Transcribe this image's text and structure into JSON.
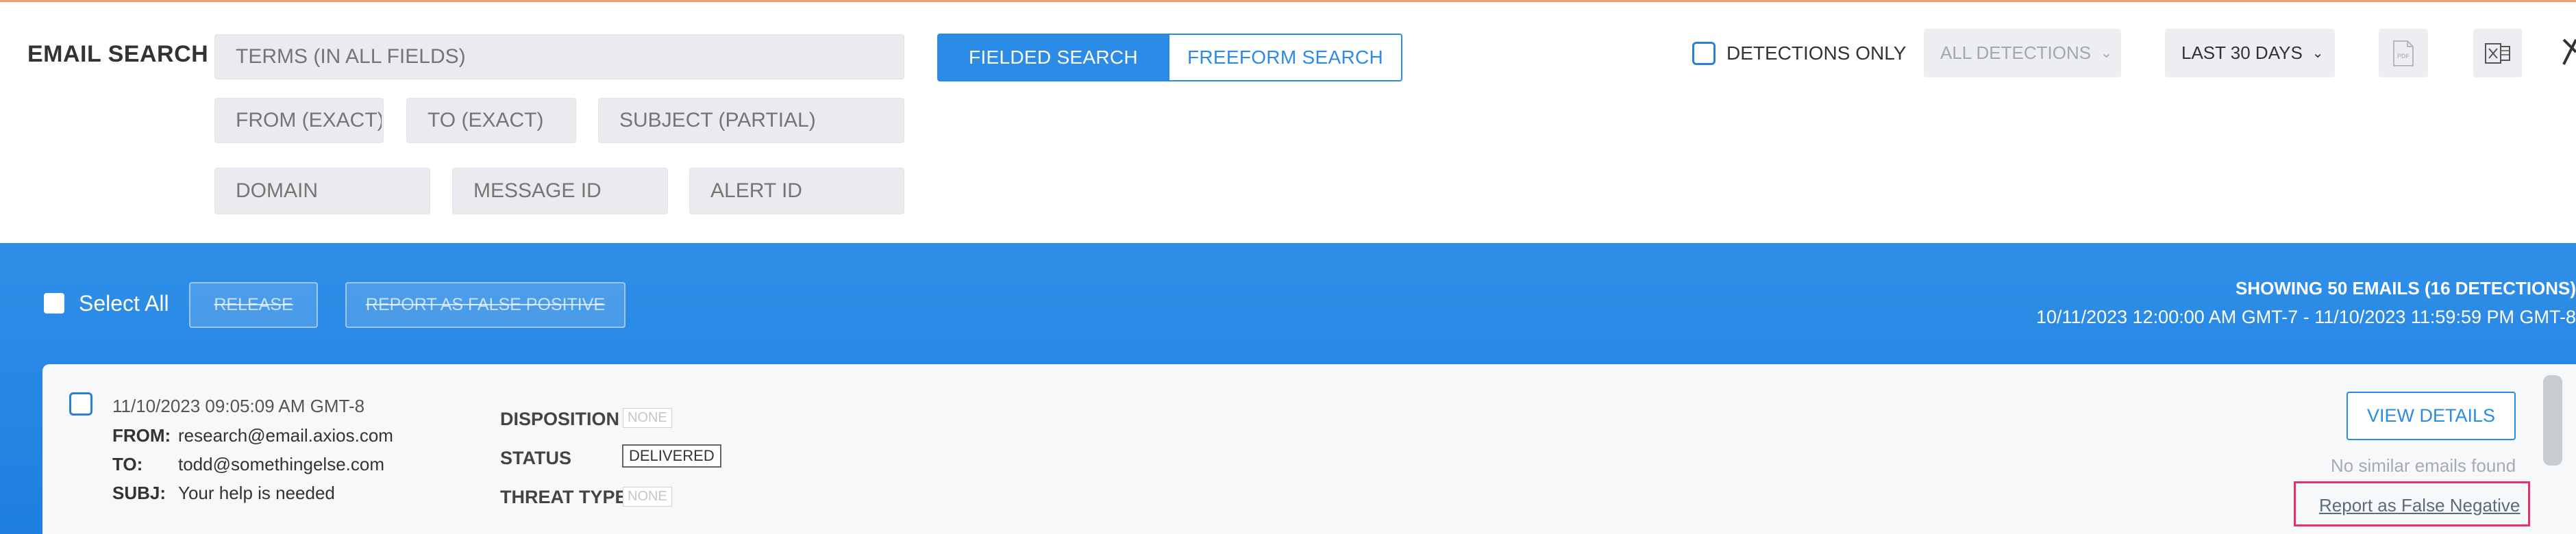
{
  "header": {
    "title": "EMAIL SEARCH",
    "terms_placeholder": "TERMS (IN ALL FIELDS)",
    "from_placeholder": "FROM (EXACT)",
    "to_placeholder": "TO (EXACT)",
    "subject_placeholder": "SUBJECT (PARTIAL)",
    "domain_placeholder": "DOMAIN",
    "message_id_placeholder": "MESSAGE ID",
    "alert_id_placeholder": "ALERT ID",
    "tabs": {
      "fielded": "FIELDED SEARCH",
      "freeform": "FREEFORM SEARCH"
    },
    "detections_only_label": "DETECTIONS ONLY",
    "all_detections": "ALL DETECTIONS",
    "date_range": "LAST 30 DAYS",
    "pdf_icon_label": "PDF"
  },
  "toolbar": {
    "select_all": "Select All",
    "release": "RELEASE",
    "report_fp": "REPORT AS FALSE POSITIVE",
    "showing": "SHOWING 50 EMAILS (16 DETECTIONS)",
    "range": "10/11/2023 12:00:00 AM GMT-7 - 11/10/2023 11:59:59 PM GMT-8"
  },
  "email": {
    "timestamp": "11/10/2023 09:05:09 AM GMT-8",
    "from_label": "FROM:",
    "from": "research@email.axios.com",
    "to_label": "TO:",
    "to": "todd@somethingelse.com",
    "subj_label": "SUBJ:",
    "subject": "Your help is needed",
    "disposition_label": "DISPOSITION",
    "disposition": "NONE",
    "status_label": "STATUS",
    "status": "DELIVERED",
    "threat_label": "THREAT TYPE",
    "threat": "NONE",
    "view_details": "VIEW DETAILS",
    "similar": "No similar emails found",
    "report_fn": "Report as False Negative"
  },
  "colors": {
    "accent": "#2b8be6",
    "band": "#1e7fe0",
    "highlight": "#e4316d"
  }
}
